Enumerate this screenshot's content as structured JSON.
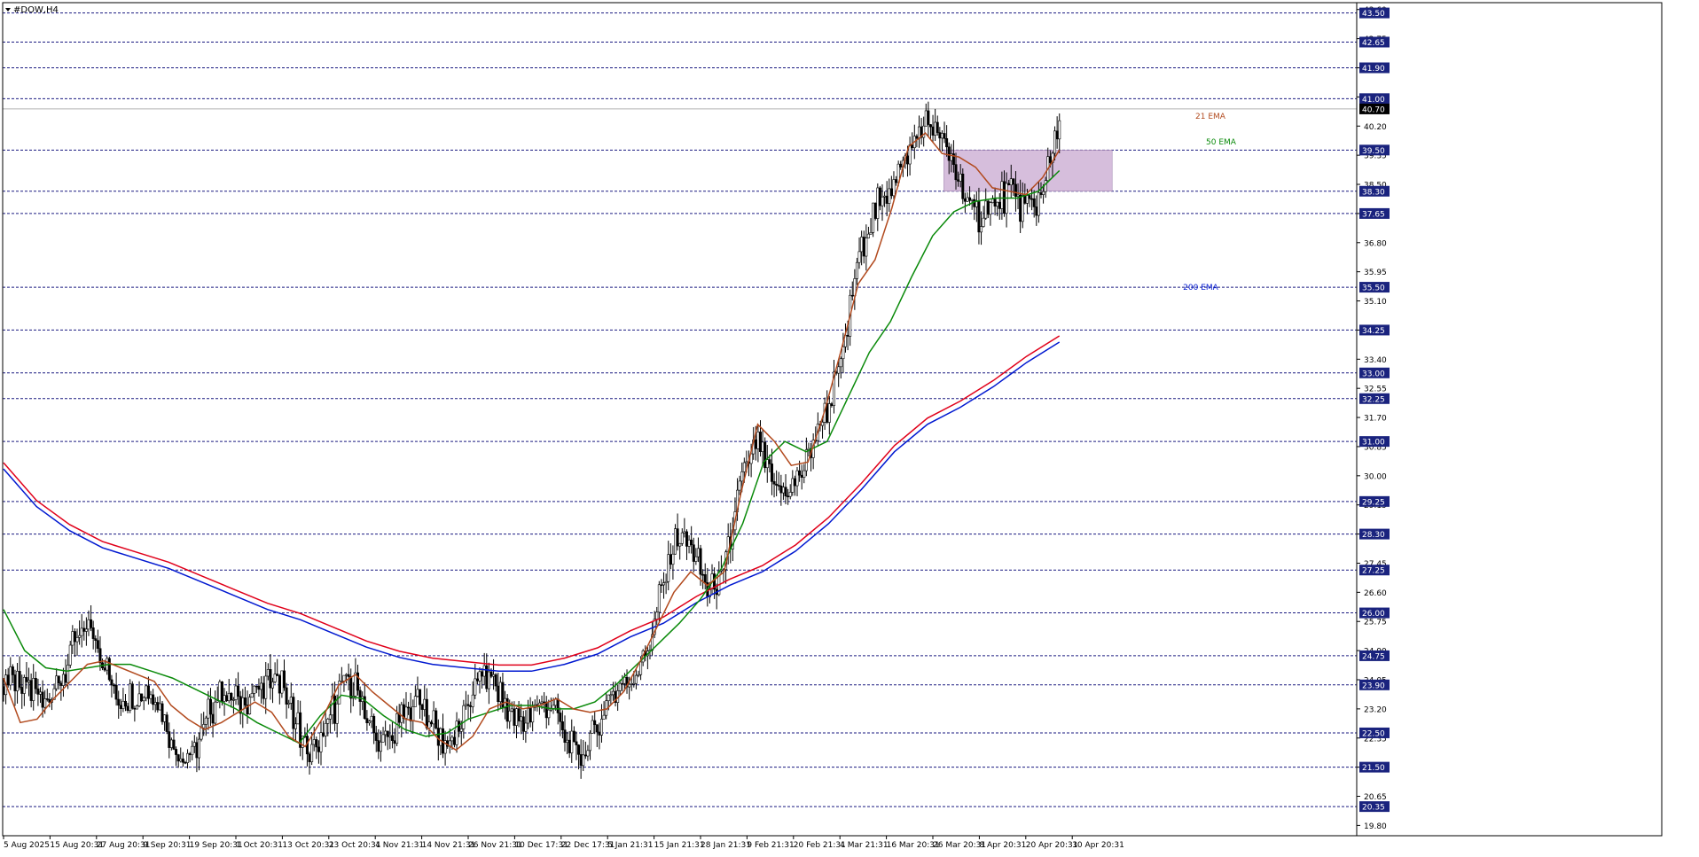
{
  "window": {
    "title": "#DOW,H4",
    "title_icon": "triangle-down-icon"
  },
  "colors": {
    "background": "#ffffff",
    "frame": "#000000",
    "grid_level": "#1a1a80",
    "bull_candle": "#ffffff",
    "bear_candle": "#000000",
    "ema21": "#b24a1e",
    "ema50": "#0a8a0a",
    "ema200_red": "#e0001a",
    "ema200_blue": "#0018d0",
    "zone_fill": "#c8a8d0",
    "price_tag_bg": "#1a237e",
    "price_tag_text": "#ffffff",
    "current_price_tag_bg": "#000000"
  },
  "chart_data": {
    "type": "candlestick",
    "symbol": "#DOW",
    "timeframe": "H4",
    "ylim": [
      19.5,
      43.8
    ],
    "y_axis_ticks": [
      "19.80",
      "20.65",
      "21.50",
      "22.35",
      "23.20",
      "24.05",
      "24.90",
      "25.75",
      "26.60",
      "27.45",
      "28.30",
      "29.15",
      "30.00",
      "30.85",
      "31.70",
      "32.55",
      "33.40",
      "34.25",
      "35.10",
      "35.95",
      "36.80",
      "37.65",
      "38.50",
      "39.35",
      "40.20",
      "41.05",
      "41.90",
      "42.75",
      "43.60"
    ],
    "x_axis_ticks": [
      "5 Aug 2025",
      "15 Aug 20:31",
      "27 Aug 20:31",
      "9 Sep 20:31",
      "19 Sep 20:31",
      "1 Oct 20:31",
      "13 Oct 20:31",
      "23 Oct 20:31",
      "4 Nov 21:31",
      "14 Nov 21:31",
      "26 Nov 21:31",
      "10 Dec 17:31",
      "22 Dec 17:31",
      "5 Jan 21:31",
      "15 Jan 21:31",
      "28 Jan 21:31",
      "9 Feb 21:31",
      "20 Feb 21:31",
      "4 Mar 21:31",
      "16 Mar 20:31",
      "26 Mar 20:31",
      "8 Apr 20:31",
      "20 Apr 20:31",
      "30 Apr 20:31"
    ],
    "horizontal_levels": [
      "43.50",
      "42.65",
      "41.90",
      "41.00",
      "39.50",
      "38.30",
      "37.65",
      "35.50",
      "34.25",
      "33.00",
      "32.25",
      "31.00",
      "29.25",
      "28.30",
      "27.25",
      "26.00",
      "24.75",
      "23.90",
      "22.50",
      "21.50",
      "20.35"
    ],
    "current_price": "40.70",
    "series": [
      {
        "name": "21 EMA",
        "values": [
          24.1,
          22.8,
          22.9,
          23.5,
          24.0,
          24.5,
          24.6,
          24.4,
          24.2,
          24.0,
          23.3,
          22.9,
          22.6,
          22.8,
          23.1,
          23.4,
          23.1,
          22.4,
          22.1,
          22.9,
          23.9,
          24.2,
          23.7,
          23.3,
          22.9,
          22.8,
          22.3,
          22.0,
          22.4,
          23.2,
          23.4,
          23.2,
          23.3,
          23.5,
          23.2,
          23.1,
          23.2,
          23.7,
          24.6,
          25.6,
          26.6,
          27.2,
          26.8,
          27.2,
          29.5,
          31.5,
          31.0,
          30.3,
          30.4,
          31.9,
          33.7,
          35.6,
          36.3,
          37.8,
          39.6,
          40.0,
          39.4,
          39.3,
          39.0,
          38.4,
          38.3,
          38.2,
          38.7,
          39.5
        ]
      },
      {
        "name": "50 EMA",
        "values": [
          26.1,
          24.9,
          24.4,
          24.3,
          24.4,
          24.5,
          24.5,
          24.3,
          24.1,
          23.8,
          23.5,
          23.2,
          22.8,
          22.5,
          22.2,
          23.0,
          23.6,
          23.5,
          23.0,
          22.6,
          22.4,
          22.5,
          22.9,
          23.1,
          23.3,
          23.3,
          23.2,
          23.2,
          23.4,
          23.9,
          24.5,
          25.1,
          25.7,
          26.4,
          27.3,
          28.6,
          30.4,
          31.0,
          30.7,
          31.0,
          32.3,
          33.6,
          34.5,
          35.8,
          37.0,
          37.7,
          38.0,
          38.1,
          38.1,
          38.3,
          38.9
        ]
      },
      {
        "name": "200 EMA",
        "values": [
          30.2,
          29.1,
          28.4,
          27.9,
          27.6,
          27.3,
          26.9,
          26.5,
          26.1,
          25.8,
          25.4,
          25.0,
          24.7,
          24.5,
          24.4,
          24.3,
          24.3,
          24.5,
          24.8,
          25.3,
          25.7,
          26.3,
          26.8,
          27.2,
          27.8,
          28.6,
          29.6,
          30.7,
          31.5,
          32.0,
          32.6,
          33.3,
          33.9
        ]
      }
    ],
    "zone": {
      "from": 38.3,
      "to": 39.5,
      "x_from": "8 Apr 20:31",
      "x_to": "30 Apr 20:31"
    },
    "annotations": [
      "21 EMA",
      "50 EMA",
      "200 EMA"
    ],
    "grid": false,
    "legend": "none"
  }
}
